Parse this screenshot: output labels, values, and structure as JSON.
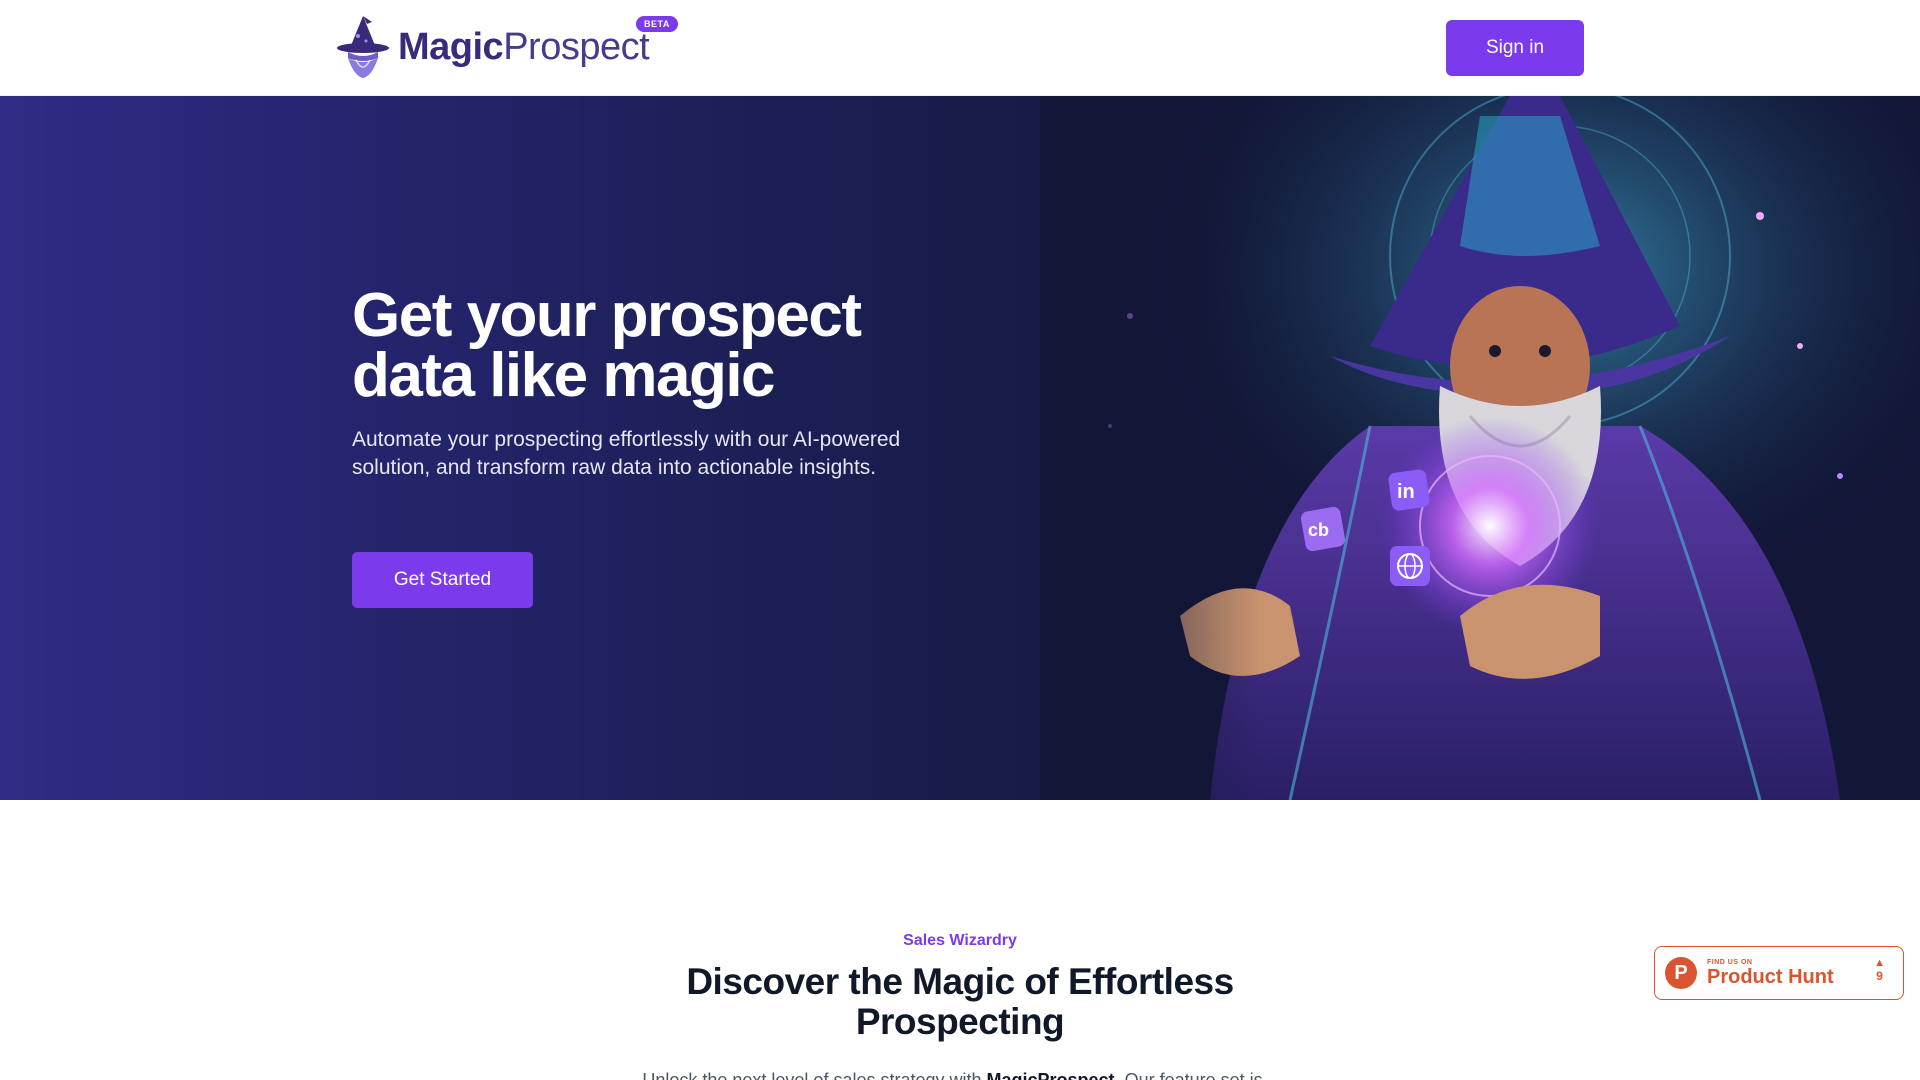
{
  "header": {
    "logo_magic": "Magic",
    "logo_prospect": "Prospect",
    "beta_badge": "BETA",
    "signin_label": "Sign in"
  },
  "hero": {
    "title_line1": "Get your prospect",
    "title_line2": "data like magic",
    "subtitle": "Automate your prospecting effortlessly with our AI-powered solution, and transform raw data into actionable insights.",
    "cta_label": "Get Started",
    "art_icons": [
      "linkedin-icon",
      "crunchbase-icon",
      "globe-icon"
    ]
  },
  "section": {
    "eyebrow": "Sales Wizardry",
    "title": "Discover the Magic of Effortless Prospecting",
    "body_start": "Unlock the next level of sales strategy with ",
    "body_brand": "MagicProspect",
    "body_end": ". Our feature set is..."
  },
  "product_hunt": {
    "find_label": "FIND US ON",
    "name": "Product Hunt",
    "logo_letter": "P",
    "arrow": "▲",
    "votes": "9"
  },
  "colors": {
    "accent": "#7c3aed",
    "hero_bg": "#1c1f55",
    "product_hunt": "#da552f"
  }
}
